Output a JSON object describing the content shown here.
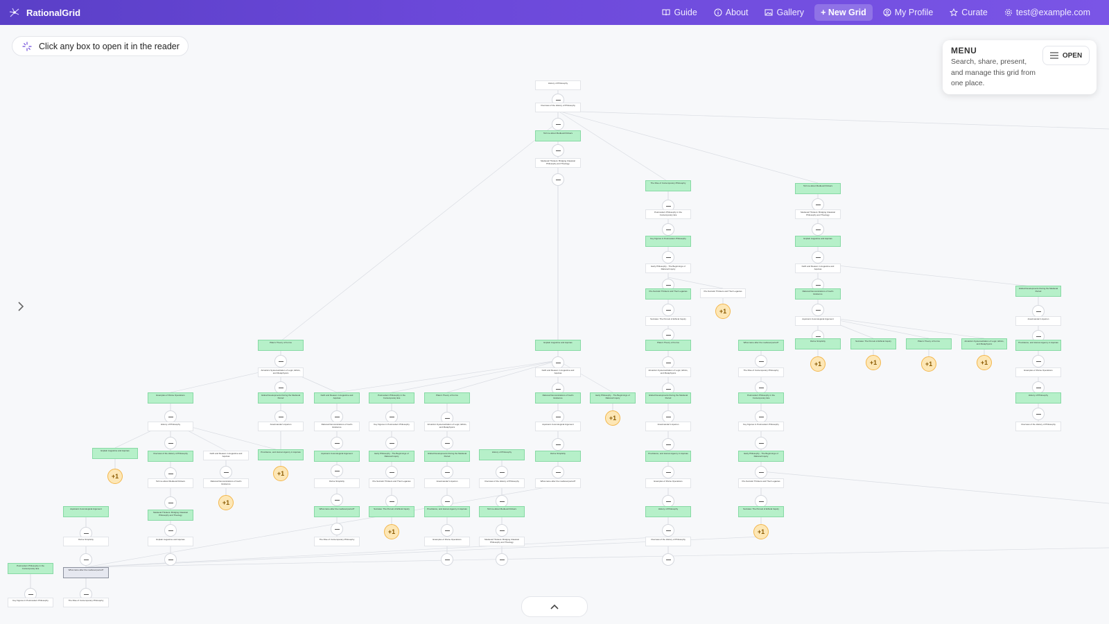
{
  "app": {
    "brand": "RationalGrid",
    "accent": "#6b48d9"
  },
  "nav": [
    {
      "label": "Guide",
      "icon": "book-icon"
    },
    {
      "label": "About",
      "icon": "info-icon"
    },
    {
      "label": "Gallery",
      "icon": "image-icon"
    },
    {
      "label": "+ New Grid",
      "icon": "",
      "active": true
    },
    {
      "label": "My Profile",
      "icon": "user-icon"
    },
    {
      "label": "Curate",
      "icon": "star-icon"
    },
    {
      "label": "test@example.com",
      "icon": "gear-icon"
    }
  ],
  "hint": {
    "text": "Click any box to open it in the reader"
  },
  "menu": {
    "title": "MENU",
    "description": "Search, share, present, and manage this grid from one place.",
    "open_label": "OPEN"
  },
  "grid": {
    "nodes": [
      "History of Philosophy",
      "Overview of the History of Philosophy",
      "Tell me about Medieval thinkers",
      "Medieval Thinkers: Bridging Classical Philosophy and Theology",
      "Explain Augustine and Aquinas",
      "Faith and Reason in Augustine and Aquinas",
      "Rational Demonstrations of God's Existence",
      "Aquinas's Cosmological Argument",
      "Divine Simplicity",
      "What came after the medieval period?",
      "The Rise of Contemporary Philosophy",
      "Postmodern Philosophy in the Contemporary Era",
      "Key Figures in Postmodern Philosophy",
      "Early Philosophy - The Beginnings of Rational Inquiry",
      "Pre-Socratic Thinkers and Their Legacies",
      "Socrates: The Pursuit of Ethical Inquiry",
      "Plato's Theory of Forms",
      "Aristotle's Systematization of Logic, Ethics, and Metaphysics",
      "Global Developments During the Medieval Period",
      "Anaximander's Apeiron",
      "Providence, and Human Agency in Aquinas",
      "Examples of Divine Operations"
    ],
    "badge_label": "+1"
  }
}
